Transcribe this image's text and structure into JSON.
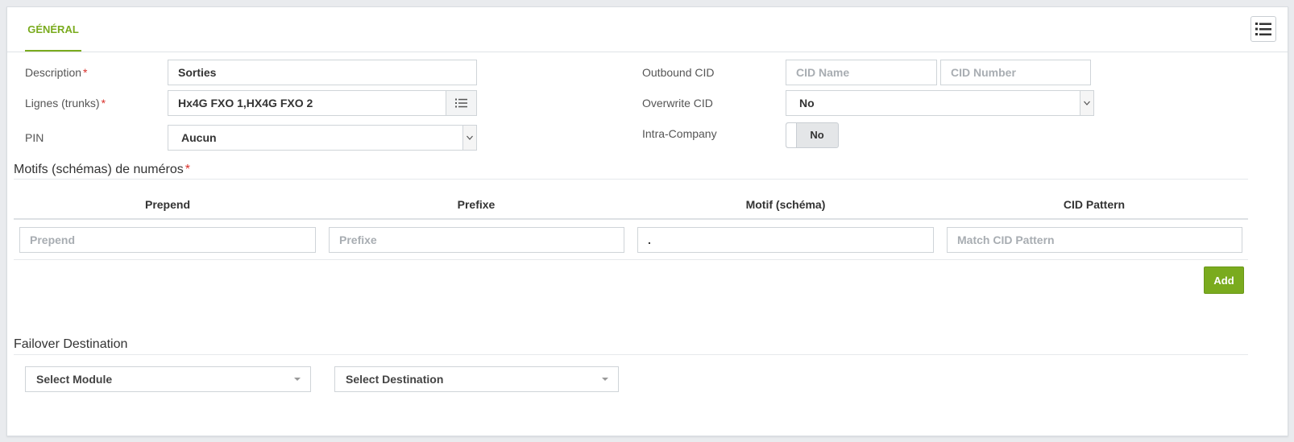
{
  "tabs": [
    {
      "label": "GÉNÉRAL"
    }
  ],
  "form": {
    "description": {
      "label": "Description",
      "required": "*",
      "value": "Sorties"
    },
    "trunks": {
      "label": "Lignes (trunks)",
      "required": "*",
      "value": "Hx4G FXO 1,HX4G FXO 2"
    },
    "pin": {
      "label": "PIN",
      "value": "Aucun"
    },
    "outbound_cid": {
      "label": "Outbound CID",
      "name_placeholder": "CID Name",
      "number_placeholder": "CID Number"
    },
    "overwrite_cid": {
      "label": "Overwrite CID",
      "value": "No"
    },
    "intra_company": {
      "label": "Intra-Company",
      "value": "No"
    }
  },
  "patterns": {
    "title": "Motifs (schémas) de numéros",
    "required": "*",
    "columns": [
      "Prepend",
      "Prefixe",
      "Motif (schéma)",
      "CID Pattern"
    ],
    "row": {
      "prepend_placeholder": "Prepend",
      "prefix_placeholder": "Prefixe",
      "pattern_value": ".",
      "cid_placeholder": "Match CID Pattern"
    },
    "add_label": "Add"
  },
  "failover": {
    "title": "Failover Destination",
    "module_label": "Select Module",
    "destination_label": "Select Destination"
  },
  "colors": {
    "accent": "#7aab1e",
    "required": "#d9302b"
  }
}
